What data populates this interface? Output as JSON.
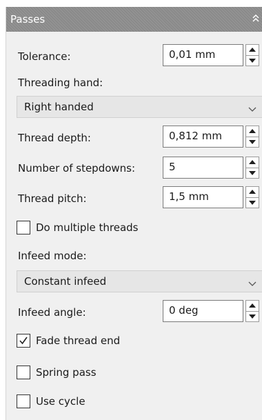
{
  "panel": {
    "title": "Passes",
    "collapse_icon": "double-chevron-up-icon"
  },
  "fields": {
    "tolerance": {
      "label": "Tolerance:",
      "value": "0,01 mm"
    },
    "threading_hand": {
      "label": "Threading hand:",
      "selected": "Right handed"
    },
    "thread_depth": {
      "label": "Thread depth:",
      "value": "0,812 mm"
    },
    "stepdowns": {
      "label": "Number of stepdowns:",
      "value": "5"
    },
    "thread_pitch": {
      "label": "Thread pitch:",
      "value": "1,5 mm"
    },
    "multiple_threads": {
      "label": "Do multiple threads",
      "checked": false
    },
    "infeed_mode": {
      "label": "Infeed mode:",
      "selected": "Constant infeed"
    },
    "infeed_angle": {
      "label": "Infeed angle:",
      "value": "0 deg"
    },
    "fade_thread_end": {
      "label": "Fade thread end",
      "checked": true
    },
    "spring_pass": {
      "label": "Spring pass",
      "checked": false
    },
    "use_cycle": {
      "label": "Use cycle",
      "checked": false
    }
  },
  "colors": {
    "header": "#8a8a8a",
    "panel": "#f0f0f0",
    "dropdown": "#e6e6e6"
  }
}
